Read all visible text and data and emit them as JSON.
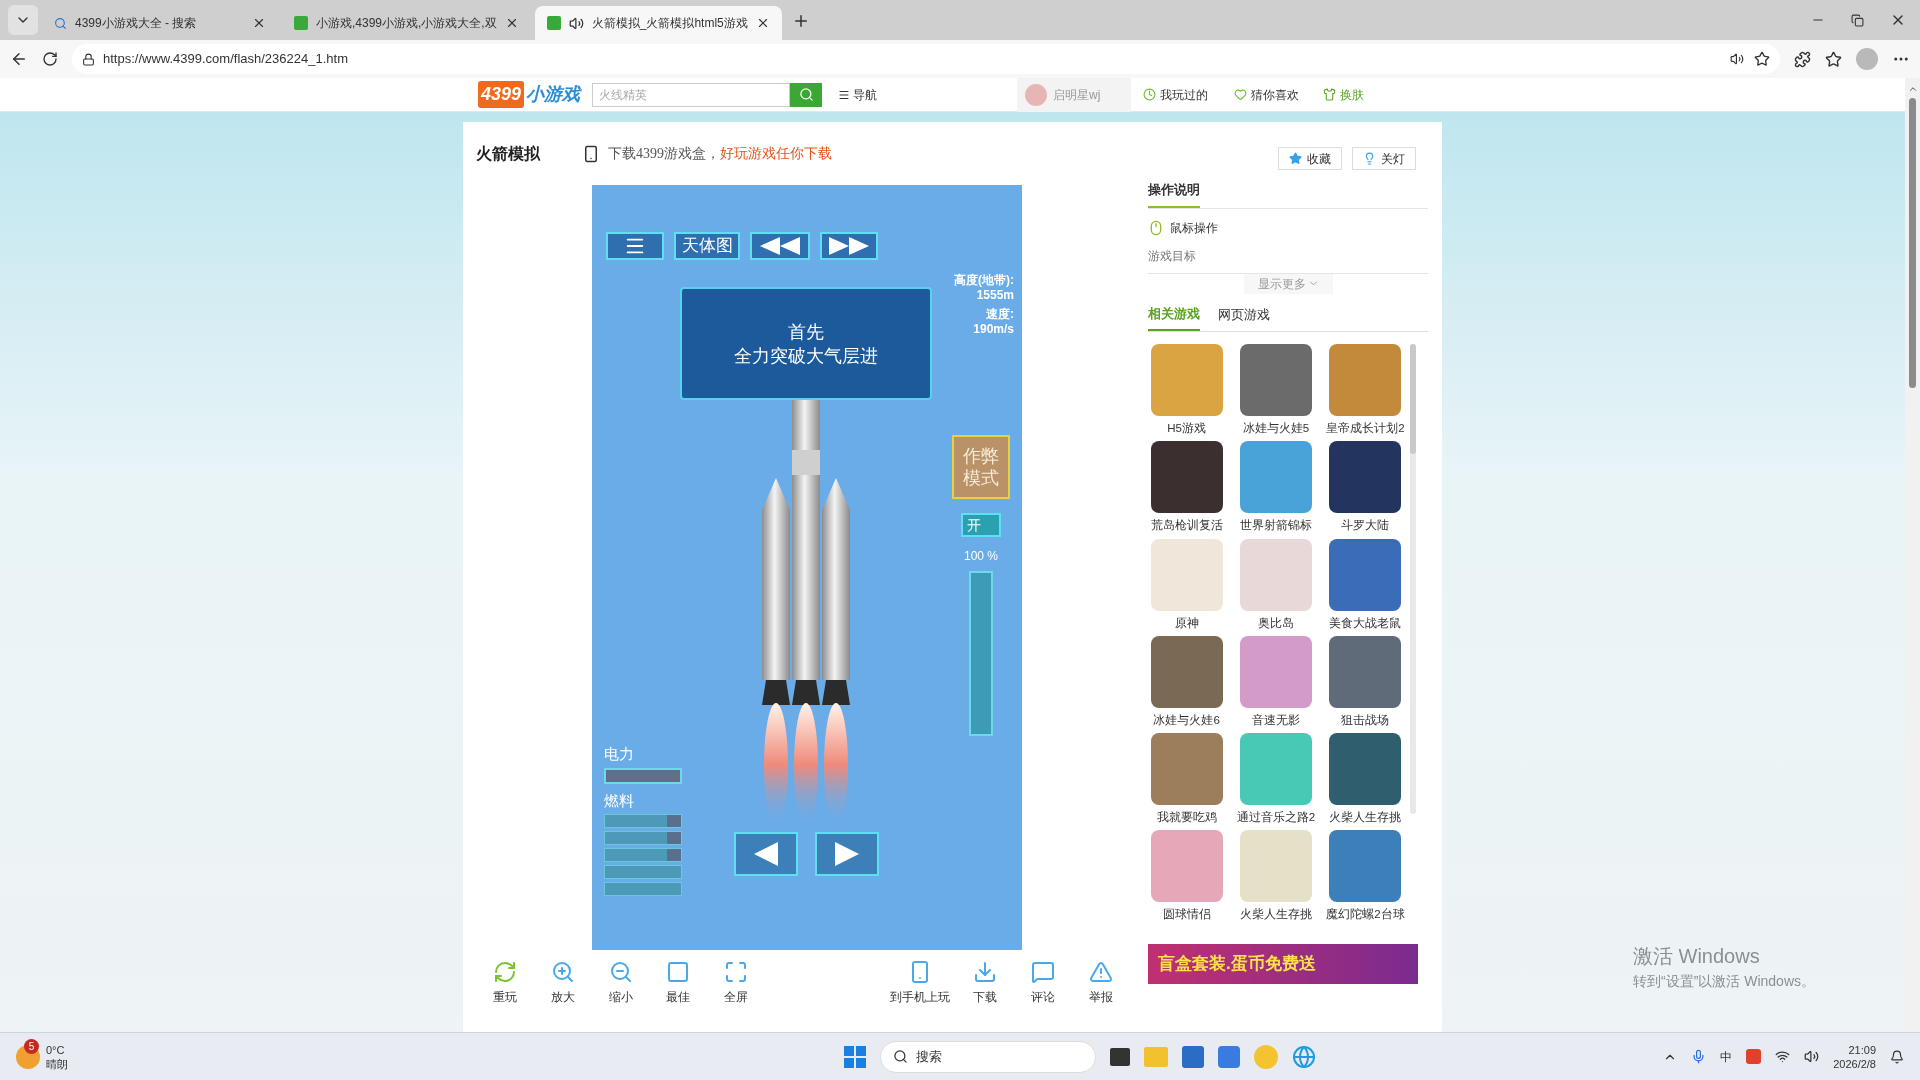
{
  "browser": {
    "tabs": [
      {
        "title": "4399小游戏大全 - 搜索",
        "kind": "search",
        "selected": false
      },
      {
        "title": "小游戏,4399小游戏,小游戏大全,双",
        "kind": "site",
        "selected": false
      },
      {
        "title": "火箭模拟_火箭模拟html5游戏",
        "kind": "site",
        "selected": true,
        "audio": true
      }
    ],
    "url": "https://www.4399.com/flash/236224_1.htm"
  },
  "site_header": {
    "logo_number": "4399",
    "logo_text": "小游戏",
    "search_placeholder": "火线精英",
    "nav": "导航",
    "user": "启明星wj",
    "played": "我玩过的",
    "guess": "猜你喜欢",
    "skin": "换肤"
  },
  "game_header": {
    "title": "火箭模拟",
    "promo": "下载4399游戏盒，",
    "promo_link": "好玩游戏任你下载",
    "favorite": "收藏",
    "lights_off": "关灯"
  },
  "game": {
    "toolbar": [
      {
        "kind": "menu"
      },
      {
        "kind": "text",
        "label": "天体图"
      },
      {
        "kind": "rewind"
      },
      {
        "kind": "forward"
      }
    ],
    "message": [
      "首先",
      "全力突破大气层进"
    ],
    "stats": [
      {
        "label": "高度(地带):",
        "value": "1555m"
      },
      {
        "label": "速度:",
        "value": "190m/s"
      }
    ],
    "power": {
      "label": "电力",
      "level": 1
    },
    "fuel": {
      "label": "燃料",
      "tanks": [
        {
          "marked": true
        },
        {
          "marked": true
        },
        {
          "marked": true
        },
        {
          "marked": false
        },
        {
          "marked": false
        }
      ]
    },
    "cheat": "作弊模式",
    "toggle": {
      "label": "开",
      "on": true
    },
    "throttle": {
      "reading": "100 %",
      "level": 1
    }
  },
  "game_tools": [
    {
      "kind": "replay",
      "label": "重玩"
    },
    {
      "kind": "zoom_in",
      "label": "放大"
    },
    {
      "kind": "zoom_out",
      "label": "缩小"
    },
    {
      "kind": "best",
      "label": "最佳"
    },
    {
      "kind": "fullscreen",
      "label": "全屏"
    },
    {
      "kind": "phone",
      "label": "到手机上玩"
    },
    {
      "kind": "download",
      "label": "下载"
    },
    {
      "kind": "comment",
      "label": "评论"
    },
    {
      "kind": "report",
      "label": "举报"
    }
  ],
  "sidebar": {
    "heading": "操作说明",
    "mouse": "鼠标操作",
    "goal": "游戏目标",
    "more": "显示更多",
    "tabs": [
      {
        "label": "相关游戏",
        "selected": true
      },
      {
        "label": "网页游戏",
        "selected": false
      }
    ],
    "games": [
      "H5游戏",
      "冰娃与火娃5",
      "皇帝成长计划2",
      "荒岛枪训复活",
      "世界射箭锦标",
      "斗罗大陆",
      "原神",
      "奥比岛",
      "美食大战老鼠",
      "冰娃与火娃6",
      "音速无影",
      "狙击战场",
      "我就要吃鸡",
      "通过音乐之路2",
      "火柴人生存挑",
      "圆球情侣",
      "火柴人生存挑",
      "魔幻陀螺2台球"
    ],
    "banner": "盲盒套装.蛋币免费送"
  },
  "activation": {
    "title": "激活 Windows",
    "hint": "转到“设置”以激活 Windows。"
  },
  "taskbar": {
    "weather_badge": "5",
    "temperature": "0°C",
    "weather": "晴朗",
    "search": "搜索",
    "ime": "中",
    "time": "21:09",
    "date": "2026/2/8"
  }
}
